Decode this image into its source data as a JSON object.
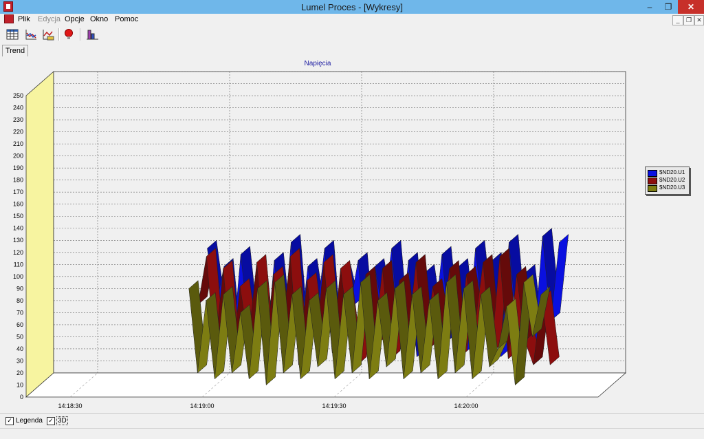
{
  "window": {
    "title": "Lumel Proces - [Wykresy]",
    "min": "–",
    "max": "❐",
    "close": "✕"
  },
  "menu": [
    {
      "label": "Plik",
      "enabled": true
    },
    {
      "label": "Edycja",
      "enabled": false
    },
    {
      "label": "Opcje",
      "enabled": true
    },
    {
      "label": "Okno",
      "enabled": true
    },
    {
      "label": "Pomoc",
      "enabled": true
    }
  ],
  "mdi_controls": {
    "min": "_",
    "restore": "❐",
    "close": "✕"
  },
  "toolbar": [
    {
      "icon": "table-icon"
    },
    {
      "icon": "line-chart-icon"
    },
    {
      "icon": "chart-settings-icon"
    },
    {
      "icon": "alarm-bulb-icon"
    },
    {
      "icon": "bar-chart-icon"
    }
  ],
  "tabs": [
    {
      "label": "Trend"
    }
  ],
  "bottom": {
    "legend_label": "Legenda",
    "legend_checked": true,
    "threed_label": "3D",
    "threed_checked": true
  },
  "chart_data": {
    "type": "line",
    "style": "3d-ribbon",
    "title": "Napięcia",
    "ylim": [
      0,
      250
    ],
    "yticks": [
      0,
      10,
      20,
      30,
      40,
      50,
      60,
      70,
      80,
      90,
      100,
      110,
      120,
      130,
      140,
      150,
      160,
      170,
      180,
      190,
      200,
      210,
      220,
      230,
      240,
      250
    ],
    "xlim": [
      "14:18:20",
      "14:20:30"
    ],
    "xticks": [
      "14:18:30",
      "14:19:00",
      "14:19:30",
      "14:20:00"
    ],
    "grid": true,
    "legend_position": "right",
    "series": [
      {
        "name": "$ND20.U1",
        "color": "#0a10e0",
        "values": [
          110,
          60,
          95,
          25,
          105,
          40,
          90,
          20,
          100,
          35,
          115,
          30,
          95,
          50,
          110,
          20,
          90,
          60,
          100,
          25,
          95,
          55,
          110,
          30,
          100,
          20,
          90,
          40,
          105,
          35,
          95,
          25,
          110,
          45,
          100,
          20,
          115,
          40,
          90,
          30,
          120,
          50,
          115
        ]
      },
      {
        "name": "$ND20.U2",
        "color": "#8c0e0e",
        "values": [
          70,
          110,
          30,
          100,
          20,
          85,
          40,
          105,
          25,
          95,
          45,
          110,
          20,
          90,
          35,
          105,
          30,
          100,
          45,
          20,
          95,
          35,
          100,
          25,
          90,
          40,
          105,
          30,
          85,
          45,
          100,
          25,
          95,
          50,
          105,
          30,
          110,
          25,
          95,
          40,
          20,
          75,
          20
        ]
      },
      {
        "name": "$ND20.U3",
        "color": "#7d7d12",
        "values": [
          90,
          20,
          80,
          15,
          85,
          20,
          70,
          15,
          90,
          10,
          95,
          20,
          85,
          15,
          80,
          25,
          90,
          15,
          85,
          20,
          95,
          15,
          80,
          25,
          90,
          15,
          85,
          20,
          80,
          15,
          95,
          20,
          90,
          15,
          85,
          25,
          40,
          75,
          10,
          95,
          50,
          85
        ]
      }
    ]
  },
  "colors": {
    "wall": "#f7f4a0",
    "floor": "#ffffff",
    "plot_bg": "#f0f0f0",
    "title": "#1a1aa0"
  }
}
